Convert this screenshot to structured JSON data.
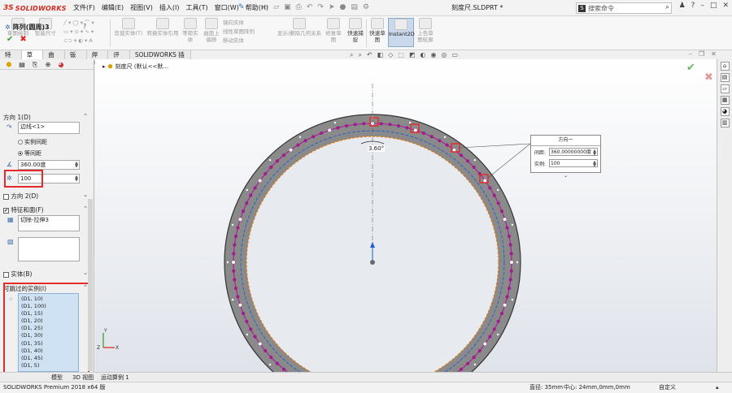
{
  "titlebar": {
    "logo_ds": "3S",
    "logo_text": "SOLIDWORKS",
    "menu": [
      "文件(F)",
      "编辑(E)",
      "视图(V)",
      "插入(I)",
      "工具(T)",
      "窗口(W)",
      "帮助(H)"
    ],
    "document_title": "刻度尺.SLDPRT *",
    "search_placeholder": "搜索命令"
  },
  "ribbon": {
    "buttons": [
      "草图绘制",
      "智能尺寸",
      "剪裁实体(T)",
      "转换实体引用",
      "等距实体",
      "曲面上偏移",
      "镜向实体",
      "线性草图阵列",
      "移动实体",
      "显示/删除几何关系",
      "修复草图",
      "快速捕捉",
      "快速草图",
      "Instant2D",
      "上色草图轮廓"
    ],
    "active_button": "Instant2D"
  },
  "command_tabs": [
    "特征",
    "草图",
    "曲面",
    "钣金",
    "焊件",
    "评估",
    "SOLIDWORKS 插件"
  ],
  "command_tabs_active": "草图",
  "property_manager": {
    "title": "阵列(圆周)3",
    "direction1": {
      "header": "方向 1(D)",
      "edge_field": "边线<1>",
      "option_instance_spacing": "实例间距",
      "option_equal_spacing": "等间距",
      "angle": "360.00度",
      "count": "100"
    },
    "direction2_header": "方向 2(D)",
    "features_header": "特征和面(F)",
    "features_list": "切除-拉伸3",
    "bodies_header": "实体(B)",
    "skip_header": "可跳过的实例(I)",
    "skip_instances": [
      "(D1, 10)",
      "(D1, 100)",
      "(D1, 15)",
      "(D1, 20)",
      "(D1, 25)",
      "(D1, 30)",
      "(D1, 35)",
      "(D1, 40)",
      "(D1, 45)",
      "(D1, 5)"
    ]
  },
  "viewport": {
    "feature_path": "刻度尺 (默认<<默...",
    "dim_label": "3.60°"
  },
  "callout": {
    "title": "方向一",
    "spacing_label": "间距:",
    "spacing_value": "360.00000000度",
    "count_label": "实例:",
    "count_value": "100"
  },
  "bottom_tabs": [
    "模型",
    "3D 视图",
    "运动算例 1"
  ],
  "statusbar": {
    "left": "SOLIDWORKS Premium 2018 x64 版",
    "diameter": "直径: 35mm",
    "center": "中心: 24mm,0mm,0mm",
    "right": "自定义"
  },
  "colors": {
    "accent_red": "#e42a2a",
    "ring_gray": "#8a8a8a",
    "pattern_magenta": "#b0179c",
    "centerline_blue": "#1e5fd0",
    "edge_orange": "#e0750f"
  }
}
